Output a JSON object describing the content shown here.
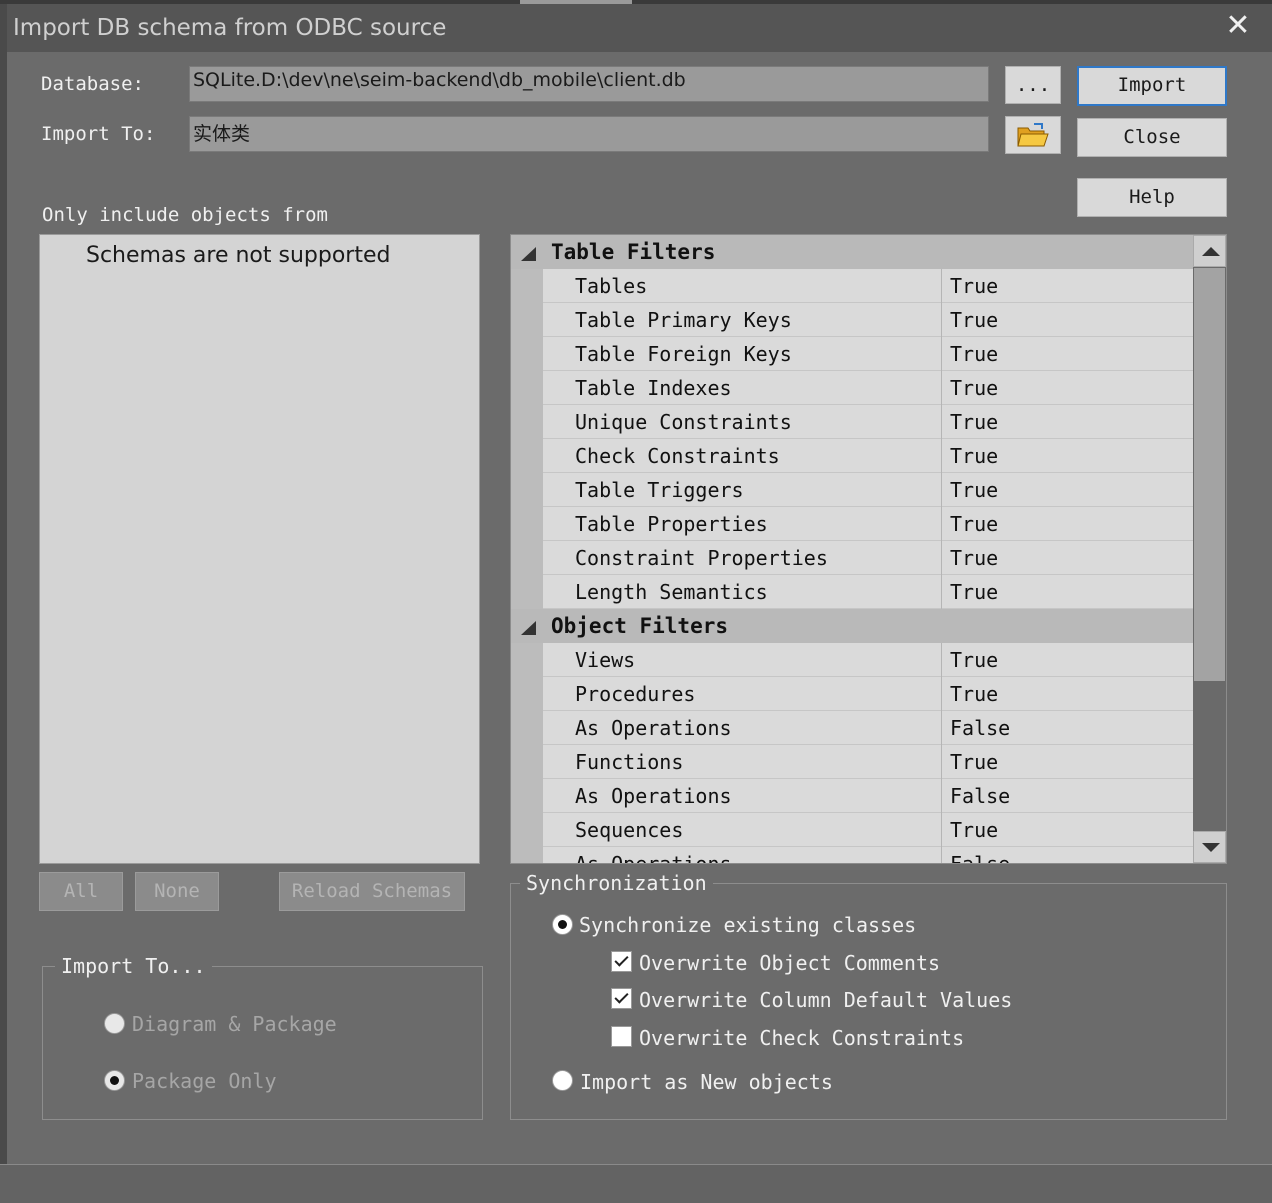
{
  "dialog": {
    "title": "Import DB schema from ODBC source",
    "close_glyph": "✕"
  },
  "form": {
    "database_label": "Database:",
    "database_value": "SQLite.D:\\dev\\ne\\seim-backend\\db_mobile\\client.db",
    "browse_label": "...",
    "import_to_label": "Import To:",
    "import_to_value": "实体类",
    "folder_icon": "folder-open-icon"
  },
  "buttons": {
    "import": "Import",
    "close": "Close",
    "help": "Help"
  },
  "schemas": {
    "heading": "Only include objects from",
    "message": "Schemas are not supported",
    "all": "All",
    "none": "None",
    "reload": "Reload Schemas"
  },
  "filters": {
    "table_category": "Table Filters",
    "table_rows": [
      {
        "name": "Tables",
        "value": "True"
      },
      {
        "name": "Table Primary Keys",
        "value": "True"
      },
      {
        "name": "Table Foreign Keys",
        "value": "True"
      },
      {
        "name": "Table Indexes",
        "value": "True"
      },
      {
        "name": "Unique Constraints",
        "value": "True"
      },
      {
        "name": "Check Constraints",
        "value": "True"
      },
      {
        "name": "Table Triggers",
        "value": "True"
      },
      {
        "name": "Table Properties",
        "value": "True"
      },
      {
        "name": "Constraint Properties",
        "value": "True"
      },
      {
        "name": "Length Semantics",
        "value": "True"
      }
    ],
    "object_category": "Object Filters",
    "object_rows": [
      {
        "name": "Views",
        "value": "True"
      },
      {
        "name": "Procedures",
        "value": "True"
      },
      {
        "name": "As Operations",
        "value": "False"
      },
      {
        "name": "Functions",
        "value": "True"
      },
      {
        "name": "As Operations",
        "value": "False"
      },
      {
        "name": "Sequences",
        "value": "True"
      },
      {
        "name": "As Operations",
        "value": "False"
      }
    ]
  },
  "import_to_group": {
    "legend": "Import To...",
    "option_diagram": "Diagram & Package",
    "option_package": "Package Only",
    "selected": "Package Only"
  },
  "sync_group": {
    "legend": "Synchronization",
    "option_sync": "Synchronize existing classes",
    "overwrite_comments": "Overwrite Object Comments",
    "overwrite_defaults": "Overwrite Column Default Values",
    "overwrite_checks": "Overwrite Check Constraints",
    "option_new": "Import as New objects",
    "selected": "Synchronize existing classes",
    "overwrite_comments_checked": true,
    "overwrite_defaults_checked": true,
    "overwrite_checks_checked": false
  }
}
